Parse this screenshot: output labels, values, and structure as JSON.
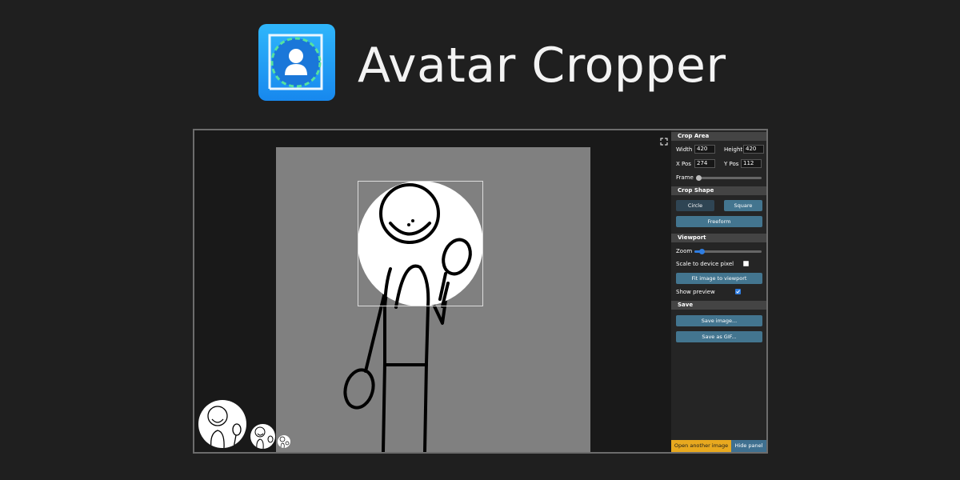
{
  "app": {
    "title": "Avatar Cropper",
    "logo_icon": "crop-avatar-logo-icon"
  },
  "colors": {
    "background": "#1f1f1f",
    "logo_gradient_top": "#2fb6fb",
    "logo_gradient_bottom": "#1788ee",
    "panel": "#252525",
    "section_header": "#444444",
    "button_primary": "#43758f",
    "button_secondary": "#2f4554",
    "accent_open": "#e8a91f",
    "hide_panel": "#3f7090",
    "canvas": "#808080"
  },
  "panel": {
    "crop_area": {
      "heading": "Crop Area",
      "width_label": "Width",
      "width_value": "420",
      "height_label": "Height",
      "height_value": "420",
      "xpos_label": "X Pos",
      "xpos_value": "274",
      "ypos_label": "Y Pos",
      "ypos_value": "112",
      "frame_label": "Frame",
      "frame_fraction": 0
    },
    "crop_shape": {
      "heading": "Crop Shape",
      "circle_label": "Circle",
      "square_label": "Square",
      "freeform_label": "Freeform"
    },
    "viewport": {
      "heading": "Viewport",
      "zoom_label": "Zoom",
      "zoom_fraction": 0.08,
      "scale_label": "Scale to device pixel",
      "scale_checked": false,
      "fit_label": "Fit image to viewport",
      "preview_label": "Show preview",
      "preview_checked": true
    },
    "save": {
      "heading": "Save",
      "save_image_label": "Save image...",
      "save_gif_label": "Save as GIF..."
    },
    "footer": {
      "open_label": "Open another image",
      "hide_label": "Hide panel"
    }
  },
  "viewport_icons": {
    "fullscreen": "fullscreen-icon"
  }
}
